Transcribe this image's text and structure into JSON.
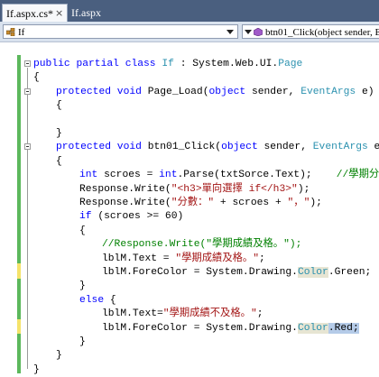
{
  "tabs": [
    {
      "label": "If.aspx.cs*",
      "active": true,
      "close_glyph": "×"
    },
    {
      "label": "If.aspx",
      "active": false
    }
  ],
  "nav": {
    "class_dropdown": "If",
    "member_dropdown": "btn01_Click(object sender, Even"
  },
  "code": {
    "l1_kw": "public partial class",
    "l1_cls": "If",
    "l1_rest": " : System.Web.UI.",
    "l1_page": "Page",
    "l2": "{",
    "l3_kw": "protected void",
    "l3_name": " Page_Load(",
    "l3_obj": "object",
    "l3_sender": " sender, ",
    "l3_type": "EventArgs",
    "l3_e": " e)",
    "l4": "{",
    "l6": "}",
    "l7_kw": "protected void",
    "l7_name": " btn01_Click(",
    "l7_obj": "object",
    "l7_sender": " sender, ",
    "l7_type": "EventArgs",
    "l7_e": " e)",
    "l8": "{",
    "l9_int": "int",
    "l9_mid": " scroes = ",
    "l9_int2": "int",
    "l9_rest": ".Parse(txtSorce.Text);    ",
    "l9_cm": "//學期分數",
    "l10_a": "Response.Write(",
    "l10_str": "\"<h3>單向選擇 if</h3>\"",
    "l10_b": ");",
    "l11_a": "Response.Write(",
    "l11_str1": "\"分數：\"",
    "l11_b": " + scroes + ",
    "l11_str2": "\"，\"",
    "l11_c": ");",
    "l12_kw": "if",
    "l12_rest": " (scroes >= 60)",
    "l13": "{",
    "l14_cm": "//Response.Write(\"學期成績及格。\");",
    "l15_a": "lblM.Text = ",
    "l15_str": "\"學期成績及格。\"",
    "l15_b": ";",
    "l16_a": "lblM.ForeColor = System.Drawing.",
    "l16_color": "Color",
    "l16_b": ".Green;",
    "l17": "}",
    "l18_kw": "else",
    "l18_rest": " {",
    "l19_a": "lblM.Text=",
    "l19_str": "\"學期成績不及格。\"",
    "l19_b": ";",
    "l20_a": "lblM.ForeColor = System.Drawing.",
    "l20_color": "Color",
    "l20_sel": ".Red;",
    "l21": "}",
    "l22": "}",
    "l23": "}"
  },
  "colors": {
    "keyword": "#0000ff",
    "type": "#2b91af",
    "string": "#a31515",
    "comment": "#008000",
    "saved_change_bar": "#5cb85c",
    "unsaved_change_bar": "#f5e36a"
  }
}
